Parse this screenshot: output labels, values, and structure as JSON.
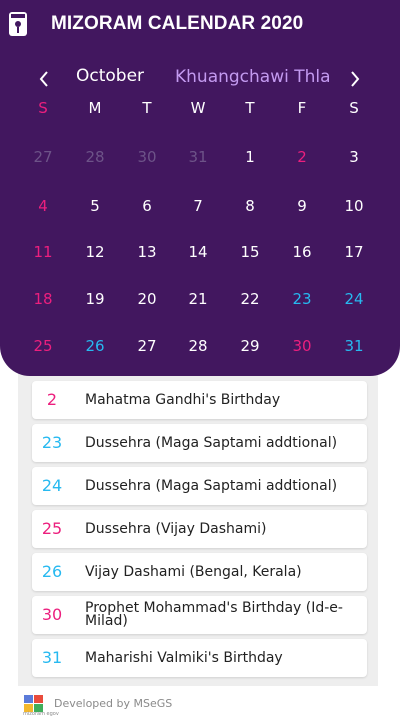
{
  "app": {
    "title": "MIZORAM CALENDAR 2020"
  },
  "nav": {
    "month": "October",
    "mizo_month": "Khuangchawi Thla"
  },
  "colors": {
    "header_bg": "#42175f",
    "holiday_pink": "#ec1f7e",
    "holiday_blue": "#27b9f0",
    "other_month": "#6d5388"
  },
  "weekdays": [
    "S",
    "M",
    "T",
    "W",
    "T",
    "F",
    "S"
  ],
  "weeks": [
    [
      {
        "d": "27",
        "t": "other"
      },
      {
        "d": "28",
        "t": "other"
      },
      {
        "d": "30",
        "t": "other"
      },
      {
        "d": "31",
        "t": "other"
      },
      {
        "d": "1",
        "t": "normal"
      },
      {
        "d": "2",
        "t": "holiday"
      },
      {
        "d": "3",
        "t": "normal"
      }
    ],
    [
      {
        "d": "4",
        "t": "sunday"
      },
      {
        "d": "5",
        "t": "normal"
      },
      {
        "d": "6",
        "t": "normal"
      },
      {
        "d": "7",
        "t": "normal"
      },
      {
        "d": "8",
        "t": "normal"
      },
      {
        "d": "9",
        "t": "normal"
      },
      {
        "d": "10",
        "t": "normal"
      }
    ],
    [
      {
        "d": "11",
        "t": "sunday"
      },
      {
        "d": "12",
        "t": "normal"
      },
      {
        "d": "13",
        "t": "normal"
      },
      {
        "d": "14",
        "t": "normal"
      },
      {
        "d": "15",
        "t": "normal"
      },
      {
        "d": "16",
        "t": "normal"
      },
      {
        "d": "17",
        "t": "normal"
      }
    ],
    [
      {
        "d": "18",
        "t": "sunday"
      },
      {
        "d": "19",
        "t": "normal"
      },
      {
        "d": "20",
        "t": "normal"
      },
      {
        "d": "21",
        "t": "normal"
      },
      {
        "d": "22",
        "t": "normal"
      },
      {
        "d": "23",
        "t": "holiday2"
      },
      {
        "d": "24",
        "t": "holiday2"
      }
    ],
    [
      {
        "d": "25",
        "t": "sunday"
      },
      {
        "d": "26",
        "t": "holiday2"
      },
      {
        "d": "27",
        "t": "normal"
      },
      {
        "d": "28",
        "t": "normal"
      },
      {
        "d": "29",
        "t": "normal"
      },
      {
        "d": "30",
        "t": "holiday"
      },
      {
        "d": "31",
        "t": "holiday2"
      }
    ]
  ],
  "events": [
    {
      "day": "2",
      "desc": "Mahatma Gandhi's Birthday",
      "color": "#ec1f7e"
    },
    {
      "day": "23",
      "desc": "Dussehra (Maga Saptami addtional)",
      "color": "#27b9f0"
    },
    {
      "day": "24",
      "desc": "Dussehra (Maga Saptami addtional)",
      "color": "#27b9f0"
    },
    {
      "day": "25",
      "desc": "Dussehra (Vijay Dashami)",
      "color": "#ec1f7e"
    },
    {
      "day": "26",
      "desc": "Vijay Dashami (Bengal, Kerala)",
      "color": "#27b9f0"
    },
    {
      "day": "30",
      "desc": "Prophet Mohammad's Birthday (Id-e-Milad)",
      "color": "#ec1f7e"
    },
    {
      "day": "31",
      "desc": "Maharishi Valmiki's Birthday",
      "color": "#27b9f0"
    }
  ],
  "footer": {
    "credit": "Developed by MSeGS",
    "logo_text": "mizoram egov"
  }
}
